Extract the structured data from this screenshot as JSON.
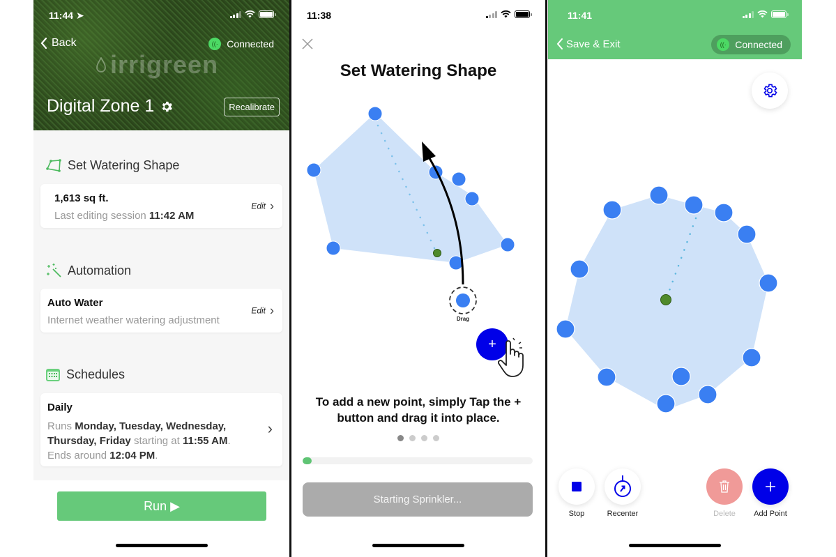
{
  "screen1": {
    "status": {
      "time": "11:44"
    },
    "nav": {
      "back_label": "Back",
      "connection_label": "Connected"
    },
    "brand": "irrigreen",
    "zone_title": "Digital Zone 1",
    "recalibrate_label": "Recalibrate",
    "sections": {
      "shape": {
        "heading": "Set Watering Shape",
        "area": "1,613 sq ft.",
        "session_prefix": "Last editing session",
        "session_time": "11:42 AM",
        "edit_label": "Edit"
      },
      "automation": {
        "heading": "Automation",
        "title": "Auto Water",
        "subtitle": "Internet weather watering adjustment",
        "edit_label": "Edit"
      },
      "schedules": {
        "heading": "Schedules",
        "title": "Daily",
        "runs_prefix": "Runs",
        "days": "Monday, Tuesday, Wednesday, Thursday, Friday",
        "starting_prefix": "starting at",
        "start_time": "11:55 AM",
        "ends_prefix": "Ends around",
        "end_time": "12:04 PM"
      }
    },
    "run_label": "Run ▶"
  },
  "screen2": {
    "status": {
      "time": "11:38"
    },
    "title": "Set Watering Shape",
    "drag_label": "Drag",
    "instruction": "To add a new point, simply Tap the + button and drag it into place.",
    "page_dots": {
      "count": 4,
      "active": 0
    },
    "progress_fraction": 0.04,
    "starting_label": "Starting Sprinkler...",
    "colors": {
      "fill": "#cfe2f9",
      "point": "#3a7ff2",
      "center": "#4f8a2b",
      "fab": "#0000e8",
      "progress": "#5fc474"
    }
  },
  "screen3": {
    "status": {
      "time": "11:41"
    },
    "save_exit_label": "Save & Exit",
    "connection_label": "Connected",
    "tools": {
      "stop": "Stop",
      "recenter": "Recenter",
      "delete": "Delete",
      "add_point": "Add Point"
    },
    "colors": {
      "header": "#66c97a",
      "accent": "#0000e8",
      "delete": "#f09a98"
    }
  }
}
